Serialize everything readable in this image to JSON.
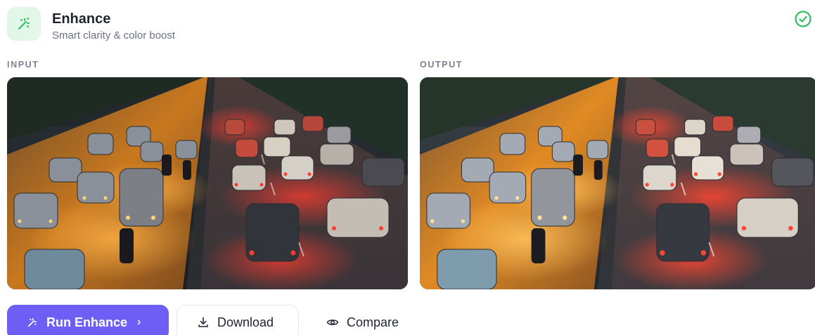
{
  "header": {
    "title": "Enhance",
    "subtitle": "Smart clarity & color boost",
    "app_icon": "magic-wand-icon",
    "status_icon": "check-circle-icon"
  },
  "panels": {
    "input_label": "INPUT",
    "output_label": "OUTPUT"
  },
  "images": {
    "input_description_icon": "traffic-photo",
    "output_description_icon": "traffic-photo-enhanced"
  },
  "actions": {
    "run_label": "Run Enhance",
    "download_label": "Download",
    "compare_label": "Compare"
  },
  "colors": {
    "accent": "#6f5ef5",
    "success": "#2fbf61",
    "icon_bg": "#e3f7e9"
  }
}
